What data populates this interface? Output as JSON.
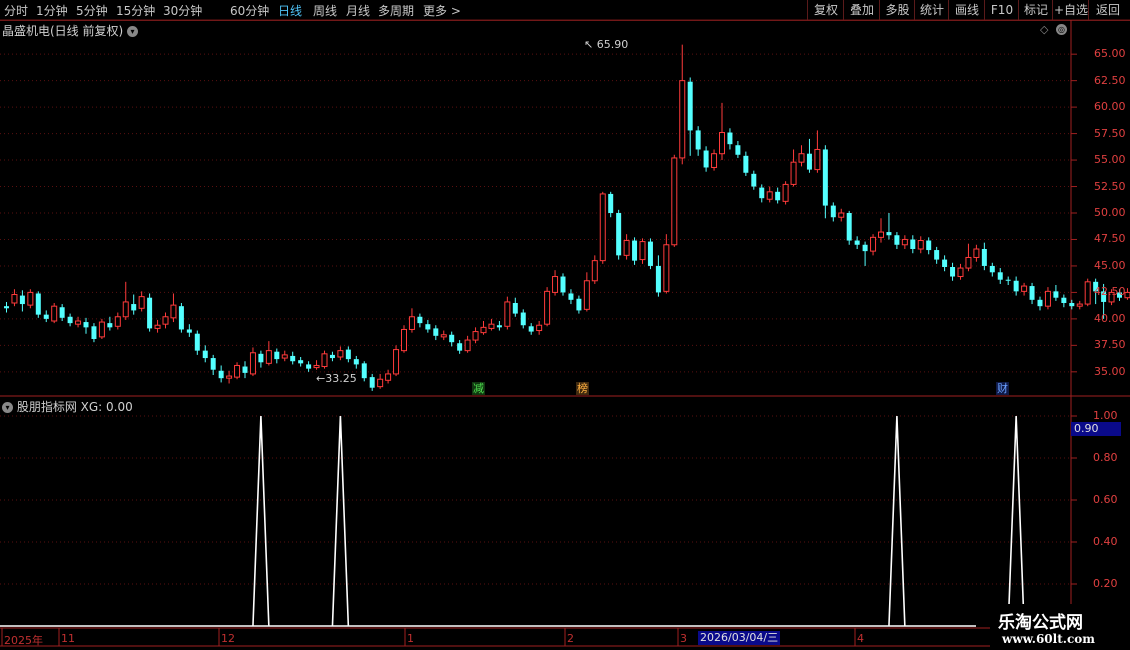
{
  "toolbar": {
    "periods": [
      "分时",
      "1分钟",
      "5分钟",
      "15分钟",
      "30分钟",
      "60分钟",
      "日线",
      "周线",
      "月线",
      "多周期",
      "更多"
    ],
    "active": "日线",
    "more_arrow": ">",
    "right_buttons": [
      "复权",
      "叠加",
      "多股",
      "统计",
      "画线",
      "F10",
      "标记",
      "+自选",
      "返回"
    ]
  },
  "stock": {
    "title": "晶盛机电(日线 前复权)"
  },
  "price_axis": {
    "labels": [
      "65.00",
      "62.50",
      "60.00",
      "57.50",
      "55.00",
      "52.50",
      "50.00",
      "47.50",
      "45.00",
      "42.50",
      "40.00",
      "37.50",
      "35.00"
    ]
  },
  "annotations": {
    "high": "65.90",
    "low": "33.25"
  },
  "events": [
    "减",
    "榜",
    "财"
  ],
  "indicator": {
    "title": "股朋指标网 XG: 0.00",
    "axis_labels": [
      "1.00",
      "0.80",
      "0.60",
      "0.40",
      "0.20"
    ],
    "current_value": "0.90"
  },
  "date_axis": {
    "labels": [
      "2025年",
      "11",
      "12",
      "1",
      "2",
      "3",
      "4"
    ],
    "cursor_date": "2026/03/04/三"
  },
  "watermark": {
    "line1": "乐淘公式网",
    "line2": "www.60lt.com"
  },
  "colors": {
    "up": "#ff3b3b",
    "down": "#54ffff",
    "axis": "#c03030",
    "grid": "#5a1010",
    "active_tab": "#4fc3f7"
  },
  "chart_data": {
    "type": "candlestick",
    "ylim": [
      33.0,
      67.0
    ],
    "ohlc": [
      [
        41.2,
        41.0,
        41.6,
        40.6
      ],
      [
        41.5,
        42.3,
        42.8,
        41.2
      ],
      [
        42.2,
        41.4,
        42.7,
        40.7
      ],
      [
        41.3,
        42.5,
        42.8,
        41.0
      ],
      [
        42.4,
        40.4,
        42.6,
        40.1
      ],
      [
        40.4,
        40.0,
        40.8,
        39.7
      ],
      [
        39.8,
        41.2,
        41.5,
        39.6
      ],
      [
        41.1,
        40.1,
        41.4,
        39.8
      ],
      [
        40.2,
        39.6,
        40.5,
        39.3
      ],
      [
        39.5,
        39.8,
        40.2,
        39.2
      ],
      [
        39.7,
        39.2,
        40.1,
        38.6
      ],
      [
        39.3,
        38.1,
        39.6,
        37.8
      ],
      [
        38.3,
        39.7,
        40.0,
        38.1
      ],
      [
        39.6,
        39.2,
        40.2,
        38.9
      ],
      [
        39.3,
        40.2,
        40.6,
        39.0
      ],
      [
        40.2,
        41.6,
        43.5,
        39.9
      ],
      [
        41.4,
        40.8,
        42.3,
        40.4
      ],
      [
        41.0,
        42.1,
        42.6,
        40.7
      ],
      [
        42.0,
        39.1,
        42.4,
        38.8
      ],
      [
        39.1,
        39.4,
        39.9,
        38.7
      ],
      [
        39.5,
        40.2,
        40.6,
        39.1
      ],
      [
        40.1,
        41.3,
        42.4,
        39.7
      ],
      [
        41.2,
        39.0,
        41.5,
        38.7
      ],
      [
        39.0,
        38.7,
        39.5,
        38.3
      ],
      [
        38.6,
        37.0,
        38.9,
        36.6
      ],
      [
        37.0,
        36.3,
        37.5,
        35.9
      ],
      [
        36.3,
        35.2,
        36.6,
        34.7
      ],
      [
        35.1,
        34.4,
        35.6,
        34.0
      ],
      [
        34.4,
        34.6,
        35.1,
        33.9
      ],
      [
        34.5,
        35.6,
        35.9,
        34.3
      ],
      [
        35.5,
        34.9,
        36.0,
        34.4
      ],
      [
        34.8,
        36.8,
        37.3,
        34.6
      ],
      [
        36.7,
        35.9,
        37.0,
        35.4
      ],
      [
        35.8,
        37.0,
        37.9,
        35.6
      ],
      [
        36.9,
        36.2,
        37.2,
        35.8
      ],
      [
        36.3,
        36.6,
        37.0,
        36.0
      ],
      [
        36.5,
        36.0,
        36.9,
        35.7
      ],
      [
        36.1,
        35.8,
        36.4,
        35.5
      ],
      [
        35.7,
        35.3,
        36.0,
        35.0
      ],
      [
        35.4,
        35.6,
        36.1,
        35.2
      ],
      [
        35.5,
        36.7,
        37.0,
        35.3
      ],
      [
        36.6,
        36.3,
        36.9,
        36.0
      ],
      [
        36.4,
        37.0,
        37.4,
        36.1
      ],
      [
        37.1,
        36.2,
        37.4,
        35.9
      ],
      [
        36.2,
        35.7,
        36.5,
        35.3
      ],
      [
        35.8,
        34.4,
        36.0,
        34.1
      ],
      [
        34.5,
        33.5,
        34.8,
        33.2
      ],
      [
        33.6,
        34.3,
        34.8,
        33.4
      ],
      [
        34.2,
        34.8,
        35.2,
        33.9
      ],
      [
        34.8,
        37.1,
        37.5,
        34.6
      ],
      [
        37.0,
        39.0,
        39.4,
        36.8
      ],
      [
        39.0,
        40.2,
        41.0,
        38.7
      ],
      [
        40.2,
        39.6,
        40.5,
        39.2
      ],
      [
        39.5,
        39.0,
        39.9,
        38.7
      ],
      [
        39.1,
        38.4,
        39.4,
        38.0
      ],
      [
        38.3,
        38.5,
        38.9,
        38.0
      ],
      [
        38.5,
        37.8,
        38.8,
        37.4
      ],
      [
        37.7,
        37.0,
        38.0,
        36.7
      ],
      [
        37.0,
        38.0,
        38.4,
        36.8
      ],
      [
        38.0,
        38.8,
        39.2,
        37.7
      ],
      [
        38.7,
        39.2,
        39.8,
        38.5
      ],
      [
        39.1,
        39.5,
        40.0,
        38.9
      ],
      [
        39.4,
        39.2,
        39.8,
        38.9
      ],
      [
        39.3,
        41.6,
        42.1,
        39.0
      ],
      [
        41.5,
        40.5,
        42.0,
        40.2
      ],
      [
        40.6,
        39.4,
        40.9,
        39.1
      ],
      [
        39.3,
        38.8,
        39.6,
        38.5
      ],
      [
        38.9,
        39.4,
        39.8,
        38.5
      ],
      [
        39.5,
        42.6,
        43.0,
        39.3
      ],
      [
        42.5,
        44.0,
        44.6,
        42.2
      ],
      [
        44.0,
        42.5,
        44.3,
        42.2
      ],
      [
        42.4,
        41.8,
        42.8,
        41.4
      ],
      [
        41.9,
        40.8,
        42.2,
        40.5
      ],
      [
        40.9,
        43.6,
        44.4,
        40.7
      ],
      [
        43.6,
        45.5,
        46.0,
        43.3
      ],
      [
        45.5,
        51.8,
        52.0,
        45.2
      ],
      [
        51.8,
        50.0,
        52.0,
        49.6
      ],
      [
        50.0,
        46.0,
        50.3,
        45.6
      ],
      [
        46.0,
        47.4,
        48.0,
        45.6
      ],
      [
        47.4,
        45.5,
        47.7,
        45.1
      ],
      [
        45.6,
        47.3,
        47.6,
        45.2
      ],
      [
        47.3,
        45.0,
        47.6,
        44.7
      ],
      [
        45.0,
        42.5,
        46.0,
        42.1
      ],
      [
        42.6,
        47.0,
        48.0,
        42.4
      ],
      [
        47.0,
        55.2,
        55.5,
        46.8
      ],
      [
        55.2,
        62.5,
        65.9,
        54.6
      ],
      [
        62.4,
        57.8,
        62.8,
        55.4
      ],
      [
        57.8,
        56.0,
        58.2,
        55.4
      ],
      [
        55.9,
        54.3,
        56.3,
        53.9
      ],
      [
        54.3,
        55.6,
        56.0,
        54.0
      ],
      [
        55.6,
        57.6,
        60.4,
        55.0
      ],
      [
        57.6,
        56.5,
        58.0,
        56.0
      ],
      [
        56.4,
        55.5,
        56.8,
        55.2
      ],
      [
        55.4,
        53.8,
        55.8,
        53.5
      ],
      [
        53.7,
        52.5,
        54.0,
        52.2
      ],
      [
        52.4,
        51.4,
        52.7,
        51.0
      ],
      [
        51.3,
        52.0,
        52.5,
        51.0
      ],
      [
        52.0,
        51.2,
        52.4,
        50.9
      ],
      [
        51.1,
        52.7,
        53.0,
        50.8
      ],
      [
        52.7,
        54.8,
        56.0,
        52.5
      ],
      [
        54.8,
        55.6,
        56.4,
        54.4
      ],
      [
        55.6,
        54.1,
        57.0,
        53.8
      ],
      [
        54.1,
        56.0,
        57.8,
        53.8
      ],
      [
        56.0,
        50.7,
        56.4,
        49.5
      ],
      [
        50.7,
        49.6,
        51.0,
        49.2
      ],
      [
        49.6,
        50.0,
        50.4,
        49.2
      ],
      [
        50.0,
        47.4,
        50.2,
        47.0
      ],
      [
        47.4,
        47.0,
        47.8,
        46.6
      ],
      [
        47.0,
        46.4,
        47.3,
        45.0
      ],
      [
        46.4,
        47.7,
        48.0,
        46.0
      ],
      [
        47.7,
        48.2,
        49.5,
        47.2
      ],
      [
        48.2,
        47.9,
        50.0,
        47.5
      ],
      [
        47.9,
        47.0,
        48.2,
        46.6
      ],
      [
        47.0,
        47.5,
        47.9,
        46.6
      ],
      [
        47.5,
        46.6,
        47.9,
        46.2
      ],
      [
        46.6,
        47.4,
        47.8,
        46.2
      ],
      [
        47.4,
        46.5,
        47.7,
        46.1
      ],
      [
        46.5,
        45.6,
        46.8,
        45.2
      ],
      [
        45.6,
        44.9,
        46.0,
        44.5
      ],
      [
        44.9,
        44.0,
        45.3,
        43.6
      ],
      [
        44.0,
        44.8,
        45.2,
        43.7
      ],
      [
        44.8,
        45.8,
        47.1,
        44.5
      ],
      [
        45.8,
        46.6,
        47.0,
        45.4
      ],
      [
        46.6,
        45.0,
        47.2,
        44.6
      ],
      [
        45.0,
        44.4,
        45.3,
        44.0
      ],
      [
        44.4,
        43.7,
        44.8,
        43.3
      ],
      [
        43.7,
        43.6,
        44.0,
        43.2
      ],
      [
        43.6,
        42.6,
        44.0,
        42.2
      ],
      [
        42.6,
        43.1,
        43.4,
        42.2
      ],
      [
        43.1,
        41.8,
        43.4,
        41.4
      ],
      [
        41.8,
        41.2,
        42.1,
        40.8
      ],
      [
        41.2,
        42.6,
        43.0,
        40.9
      ],
      [
        42.6,
        42.0,
        43.2,
        41.7
      ],
      [
        42.0,
        41.5,
        42.3,
        41.1
      ],
      [
        41.5,
        41.2,
        41.8,
        40.9
      ],
      [
        41.2,
        41.4,
        41.7,
        40.9
      ],
      [
        41.4,
        43.5,
        43.8,
        41.2
      ],
      [
        43.5,
        42.6,
        43.8,
        41.4
      ],
      [
        42.6,
        41.6,
        43.3,
        40.0
      ],
      [
        41.6,
        42.5,
        42.8,
        41.3
      ],
      [
        42.5,
        42.0,
        42.8,
        41.7
      ],
      [
        42.0,
        42.5,
        42.9,
        41.8
      ],
      [
        42.5,
        42.8,
        43.2,
        42.3
      ],
      [
        42.8,
        43.4,
        43.8,
        42.5
      ],
      [
        43.4,
        43.6,
        44.0,
        43.0
      ],
      [
        43.6,
        45.5,
        46.2,
        43.3
      ],
      [
        45.5,
        46.5,
        46.8,
        43.7
      ],
      [
        46.5,
        45.8,
        46.8,
        45.4
      ],
      [
        45.8,
        46.3,
        46.7,
        45.5
      ],
      [
        46.3,
        45.4,
        46.6,
        45.0
      ],
      [
        45.4,
        44.8,
        45.7,
        44.3
      ],
      [
        44.8,
        45.7,
        46.0,
        44.5
      ],
      [
        45.7,
        44.2,
        46.0,
        43.8
      ],
      [
        44.2,
        43.6,
        44.5,
        43.2
      ],
      [
        43.6,
        43.8,
        44.2,
        43.3
      ],
      [
        43.8,
        43.5,
        44.1,
        43.2
      ],
      [
        43.5,
        41.0,
        43.8,
        40.2
      ],
      [
        41.0,
        40.0,
        41.4,
        39.7
      ],
      [
        40.0,
        41.9,
        42.2,
        39.8
      ],
      [
        41.9,
        42.8,
        43.1,
        41.6
      ],
      [
        42.8,
        44.6,
        45.0,
        42.5
      ],
      [
        44.6,
        46.0,
        47.5,
        44.4
      ],
      [
        46.0,
        46.3,
        46.6,
        45.5
      ]
    ],
    "xg_signals": [
      32,
      42,
      112,
      127
    ]
  }
}
